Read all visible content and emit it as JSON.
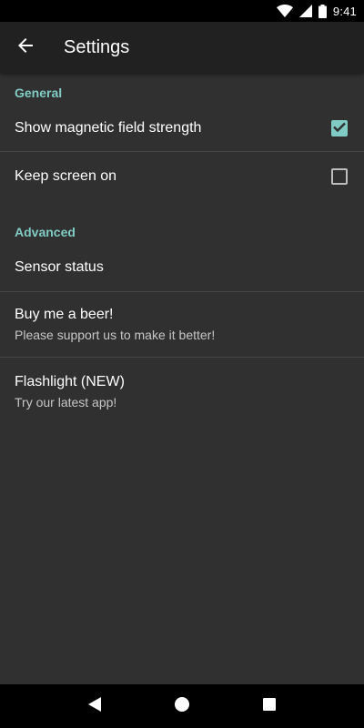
{
  "status_bar": {
    "time": "9:41",
    "icons": [
      "wifi-icon",
      "signal-icon",
      "battery-icon"
    ]
  },
  "toolbar": {
    "back_icon": "arrow-back-icon",
    "title": "Settings"
  },
  "sections": {
    "general": {
      "header": "General",
      "magnetic": {
        "title": "Show magnetic field strength",
        "checked": true
      },
      "screen_on": {
        "title": "Keep screen on",
        "checked": false
      }
    },
    "advanced": {
      "header": "Advanced",
      "sensor_status": {
        "title": "Sensor status"
      },
      "beer": {
        "title": "Buy me a beer!",
        "summary": "Please support us to make it better!"
      },
      "flashlight": {
        "title": "Flashlight (NEW)",
        "summary": "Try our latest app!"
      }
    }
  },
  "nav_bar": {
    "icons": [
      "back-triangle-icon",
      "home-circle-icon",
      "recents-square-icon"
    ]
  },
  "colors": {
    "background": "#303030",
    "toolbar": "#212121",
    "accent": "#80cbc4",
    "divider": "#464646",
    "status_bar": "#000000"
  }
}
